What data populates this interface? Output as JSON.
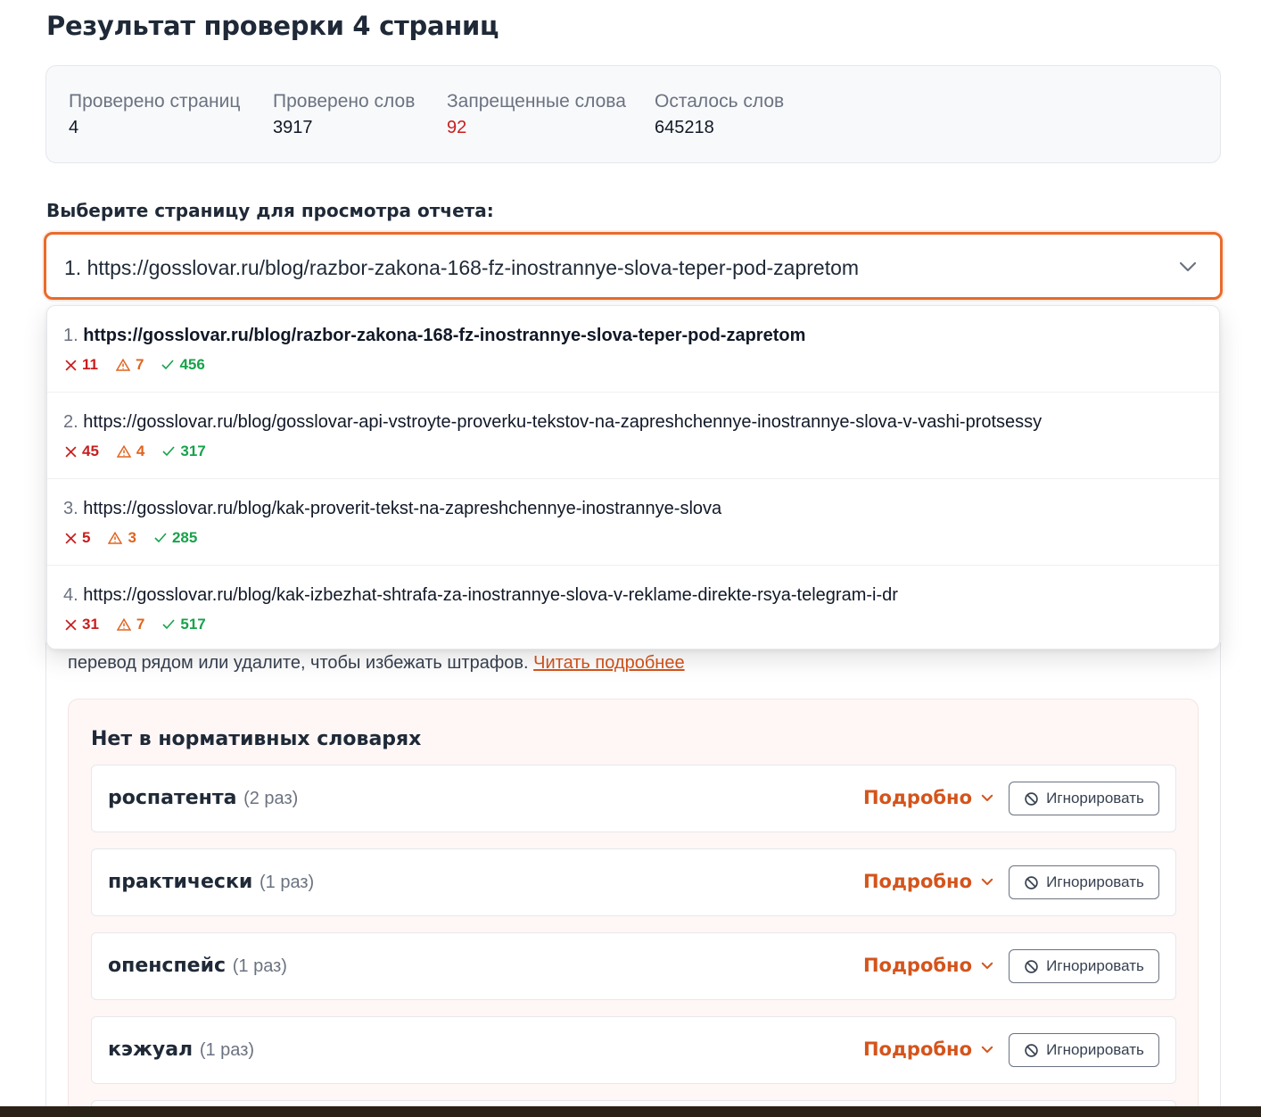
{
  "page": {
    "title": "Результат проверки 4 страниц"
  },
  "stats": [
    {
      "label": "Проверено страниц",
      "value": "4"
    },
    {
      "label": "Проверено слов",
      "value": "3917"
    },
    {
      "label": "Запрещенные слова",
      "value": "92"
    },
    {
      "label": "Осталось слов",
      "value": "645218"
    }
  ],
  "selector": {
    "label": "Выберите страницу для просмотра отчета:",
    "value": "1. https://gosslovar.ru/blog/razbor-zakona-168-fz-inostrannye-slova-teper-pod-zapretom"
  },
  "dropdown": {
    "items": [
      {
        "num": "1.",
        "url": "https://gosslovar.ru/blog/razbor-zakona-168-fz-inostrannye-slova-teper-pod-zapretom",
        "errors": "11",
        "warnings": "7",
        "ok": "456"
      },
      {
        "num": "2.",
        "url": "https://gosslovar.ru/blog/gosslovar-api-vstroyte-proverku-tekstov-na-zapreshchennye-inostrannye-slova-v-vashi-protsessy",
        "errors": "45",
        "warnings": "4",
        "ok": "317"
      },
      {
        "num": "3.",
        "url": "https://gosslovar.ru/blog/kak-proverit-tekst-na-zapreshchennye-inostrannye-slova",
        "errors": "5",
        "warnings": "3",
        "ok": "285"
      },
      {
        "num": "4.",
        "url": "https://gosslovar.ru/blog/kak-izbezhat-shtrafa-za-inostrannye-slova-v-reklame-direkte-rsya-telegram-i-dr",
        "errors": "31",
        "warnings": "7",
        "ok": "517"
      }
    ]
  },
  "notice": {
    "text": "перевод рядом или удалите, чтобы избежать штрафов.",
    "link": "Читать подробнее"
  },
  "violations": {
    "title": "Нет в нормативных словарях",
    "details_label": "Подробно",
    "ignore_label": "Игнорировать",
    "words": [
      {
        "word": "роспатента",
        "count": "(2 раз)"
      },
      {
        "word": "практически",
        "count": "(1 раз)"
      },
      {
        "word": "опенспейс",
        "count": "(1 раз)"
      },
      {
        "word": "кэжуал",
        "count": "(1 раз)"
      }
    ]
  },
  "colors": {
    "accent": "#e96b2c",
    "danger": "#c81e1e",
    "warning": "#e0641e",
    "success": "#16a34a"
  }
}
